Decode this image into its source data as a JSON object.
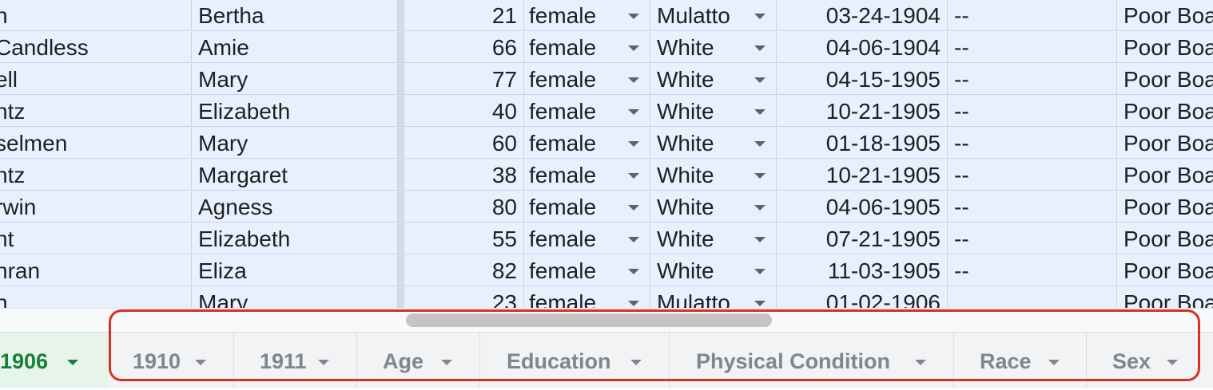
{
  "rows": [
    {
      "last": "h",
      "first": "Bertha",
      "age": "21",
      "sex": "female",
      "race": "Mulatto",
      "date": "03-24-1904",
      "extra": "--",
      "board": "Poor Boa"
    },
    {
      "last": "Candless",
      "first": "Amie",
      "age": "66",
      "sex": "female",
      "race": "White",
      "date": "04-06-1904",
      "extra": "--",
      "board": "Poor Boa"
    },
    {
      "last": "ell",
      "first": "Mary",
      "age": "77",
      "sex": "female",
      "race": "White",
      "date": "04-15-1905",
      "extra": "--",
      "board": "Poor Boa"
    },
    {
      "last": "ntz",
      "first": "Elizabeth",
      "age": "40",
      "sex": "female",
      "race": "White",
      "date": "10-21-1905",
      "extra": "--",
      "board": "Poor Boa"
    },
    {
      "last": "selmen",
      "first": "Mary",
      "age": "60",
      "sex": "female",
      "race": "White",
      "date": "01-18-1905",
      "extra": "--",
      "board": "Poor Boa"
    },
    {
      "last": "ntz",
      "first": "Margaret",
      "age": "38",
      "sex": "female",
      "race": "White",
      "date": "10-21-1905",
      "extra": "--",
      "board": "Poor Boa"
    },
    {
      "last": "rwin",
      "first": "Agness",
      "age": "80",
      "sex": "female",
      "race": "White",
      "date": "04-06-1905",
      "extra": "--",
      "board": "Poor Boa"
    },
    {
      "last": "nt",
      "first": "Elizabeth",
      "age": "55",
      "sex": "female",
      "race": "White",
      "date": "07-21-1905",
      "extra": "--",
      "board": "Poor Boa"
    },
    {
      "last": "hran",
      "first": "Eliza",
      "age": "82",
      "sex": "female",
      "race": "White",
      "date": "11-03-1905",
      "extra": "--",
      "board": "Poor Boa"
    },
    {
      "last": "h",
      "first": "Mary",
      "age": "23",
      "sex": "female",
      "race": "Mulatto",
      "date": "01-02-1906",
      "extra": "",
      "board": "Poor Boa"
    }
  ],
  "tabs": [
    {
      "label": "1906",
      "active": true
    },
    {
      "label": "1910"
    },
    {
      "label": "1911"
    },
    {
      "label": "Age"
    },
    {
      "label": "Education"
    },
    {
      "label": "Physical Condition"
    },
    {
      "label": "Race"
    },
    {
      "label": "Sex"
    }
  ],
  "colors": {
    "selection": "#e8f0fe",
    "active_tab": "#188038",
    "highlight": "#d93025"
  }
}
